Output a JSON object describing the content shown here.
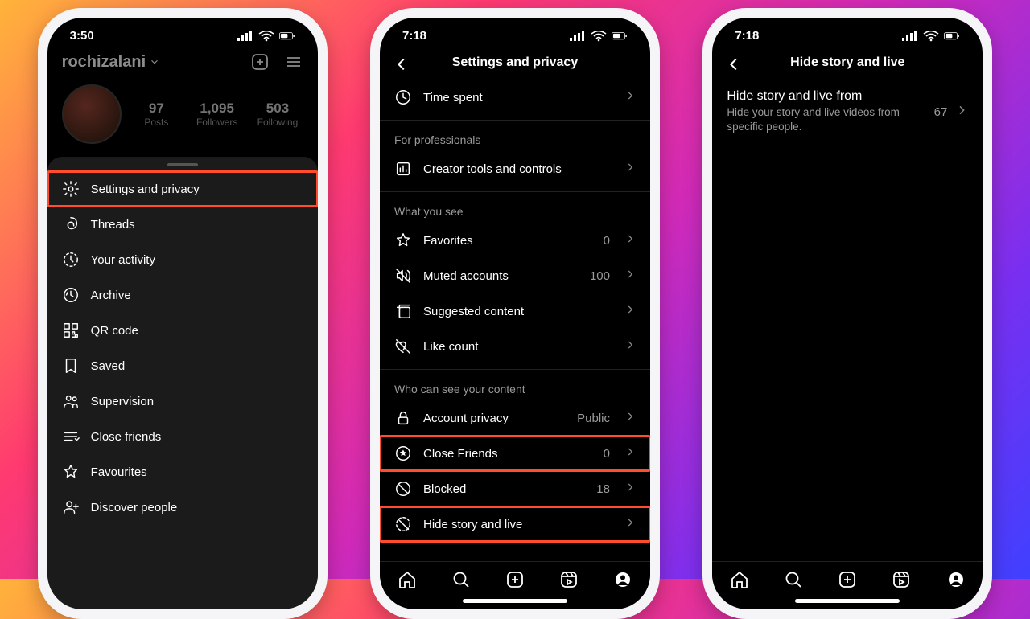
{
  "phone1": {
    "time": "3:50",
    "username": "rochizalani",
    "stats": {
      "posts": {
        "n": "97",
        "l": "Posts"
      },
      "followers": {
        "n": "1,095",
        "l": "Followers"
      },
      "following": {
        "n": "503",
        "l": "Following"
      }
    },
    "menu": [
      {
        "label": "Settings and privacy",
        "hl": true
      },
      {
        "label": "Threads"
      },
      {
        "label": "Your activity"
      },
      {
        "label": "Archive"
      },
      {
        "label": "QR code"
      },
      {
        "label": "Saved"
      },
      {
        "label": "Supervision"
      },
      {
        "label": "Close friends"
      },
      {
        "label": "Favourites"
      },
      {
        "label": "Discover people"
      }
    ]
  },
  "phone2": {
    "time": "7:18",
    "title": "Settings and privacy",
    "sections": [
      {
        "header": null,
        "items": [
          {
            "label": "Time spent"
          }
        ]
      },
      {
        "header": "For professionals",
        "items": [
          {
            "label": "Creator tools and controls"
          }
        ]
      },
      {
        "header": "What you see",
        "items": [
          {
            "label": "Favorites",
            "value": "0"
          },
          {
            "label": "Muted accounts",
            "value": "100"
          },
          {
            "label": "Suggested content"
          },
          {
            "label": "Like count"
          }
        ]
      },
      {
        "header": "Who can see your content",
        "items": [
          {
            "label": "Account privacy",
            "value": "Public"
          },
          {
            "label": "Close Friends",
            "value": "0",
            "hl": true
          },
          {
            "label": "Blocked",
            "value": "18"
          },
          {
            "label": "Hide story and live",
            "hl": true
          }
        ]
      }
    ]
  },
  "phone3": {
    "time": "7:18",
    "title": "Hide story and live",
    "block": {
      "title": "Hide story and live from",
      "sub": "Hide your story and live videos from specific people.",
      "count": "67"
    }
  }
}
